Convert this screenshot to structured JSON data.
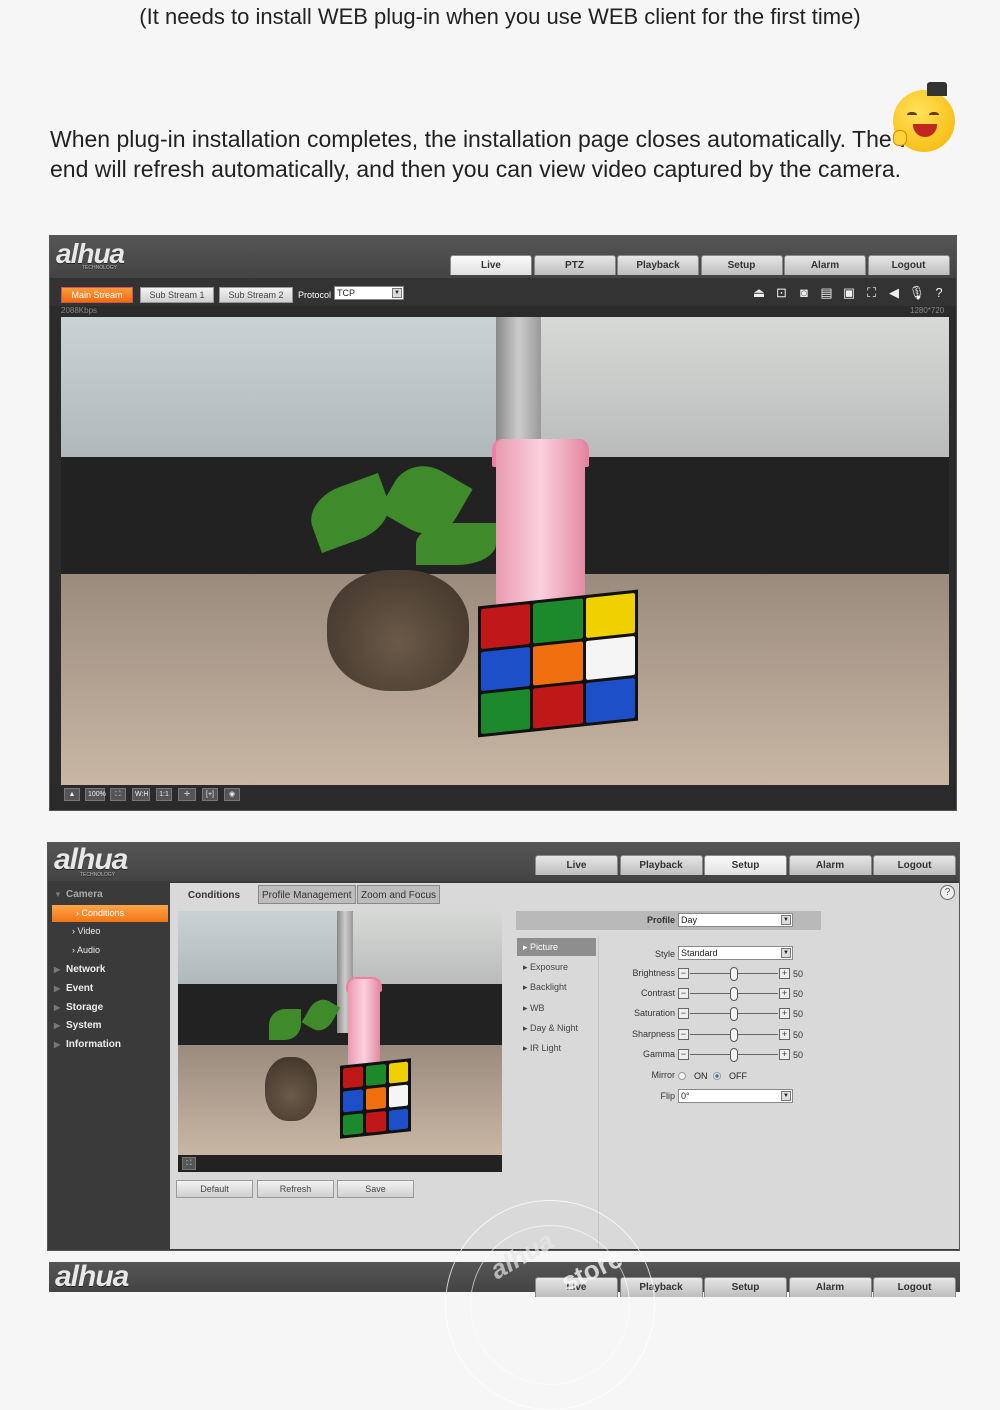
{
  "intro": {
    "note": "(It needs to install WEB plug-in when you use WEB client for the first time)",
    "paragraph": "When plug-in installation completes, the installation page closes automatically. The web-end will refresh automatically, and then you can view video captured by the camera."
  },
  "brand": {
    "logo": "alhua",
    "logo_sub": "TECHNOLOGY"
  },
  "live_page": {
    "tabs": [
      "Live",
      "PTZ",
      "Playback",
      "Setup",
      "Alarm",
      "Logout"
    ],
    "active_tab": "Live",
    "streams": [
      "Main Stream",
      "Sub Stream 1",
      "Sub Stream 2"
    ],
    "active_stream": "Main Stream",
    "protocol_label": "Protocol",
    "protocol_value": "TCP",
    "bitrate": "2088Kbps",
    "resolution": "1280*720",
    "toolbar_icons": [
      "alarm-icon",
      "zoom-area-icon",
      "snapshot-icon",
      "triple-snapshot-icon",
      "record-icon",
      "digital-zoom-icon",
      "audio-icon",
      "microphone-icon",
      "help-icon"
    ],
    "bottom_controls": {
      "zoom_level": "100%",
      "labels": [
        "W:H",
        "1:1"
      ]
    }
  },
  "setup_page": {
    "tabs": [
      "Live",
      "Playback",
      "Setup",
      "Alarm",
      "Logout"
    ],
    "active_tab": "Setup",
    "sidebar": {
      "camera": "Camera",
      "camera_items": [
        "Conditions",
        "Video",
        "Audio"
      ],
      "active_item": "Conditions",
      "sections": [
        "Network",
        "Event",
        "Storage",
        "System",
        "Information"
      ]
    },
    "content_tabs": [
      "Conditions",
      "Profile Management",
      "Zoom and Focus"
    ],
    "buttons": {
      "default": "Default",
      "refresh": "Refresh",
      "save": "Save"
    },
    "profile": {
      "label": "Profile",
      "value": "Day"
    },
    "menu": [
      "Picture",
      "Exposure",
      "Backlight",
      "WB",
      "Day & Night",
      "IR Light"
    ],
    "active_menu": "Picture",
    "style": {
      "label": "Style",
      "value": "Standard"
    },
    "sliders": [
      {
        "label": "Brightness",
        "value": 50
      },
      {
        "label": "Contrast",
        "value": 50
      },
      {
        "label": "Saturation",
        "value": 50
      },
      {
        "label": "Sharpness",
        "value": 50
      },
      {
        "label": "Gamma",
        "value": 50
      }
    ],
    "slider_max": 100,
    "mirror": {
      "label": "Mirror",
      "on": "ON",
      "off": "OFF",
      "selected": "OFF"
    },
    "flip": {
      "label": "Flip",
      "value": "0°"
    }
  },
  "third_page": {
    "tabs": [
      "Live",
      "Playback",
      "Setup",
      "Alarm",
      "Logout"
    ]
  },
  "watermark": {
    "text": "alhua",
    "store": "store"
  },
  "colors": {
    "accent_orange": "#f07516",
    "header_gray": "#4a4a4a",
    "panel_gray": "#d9d9d9"
  }
}
